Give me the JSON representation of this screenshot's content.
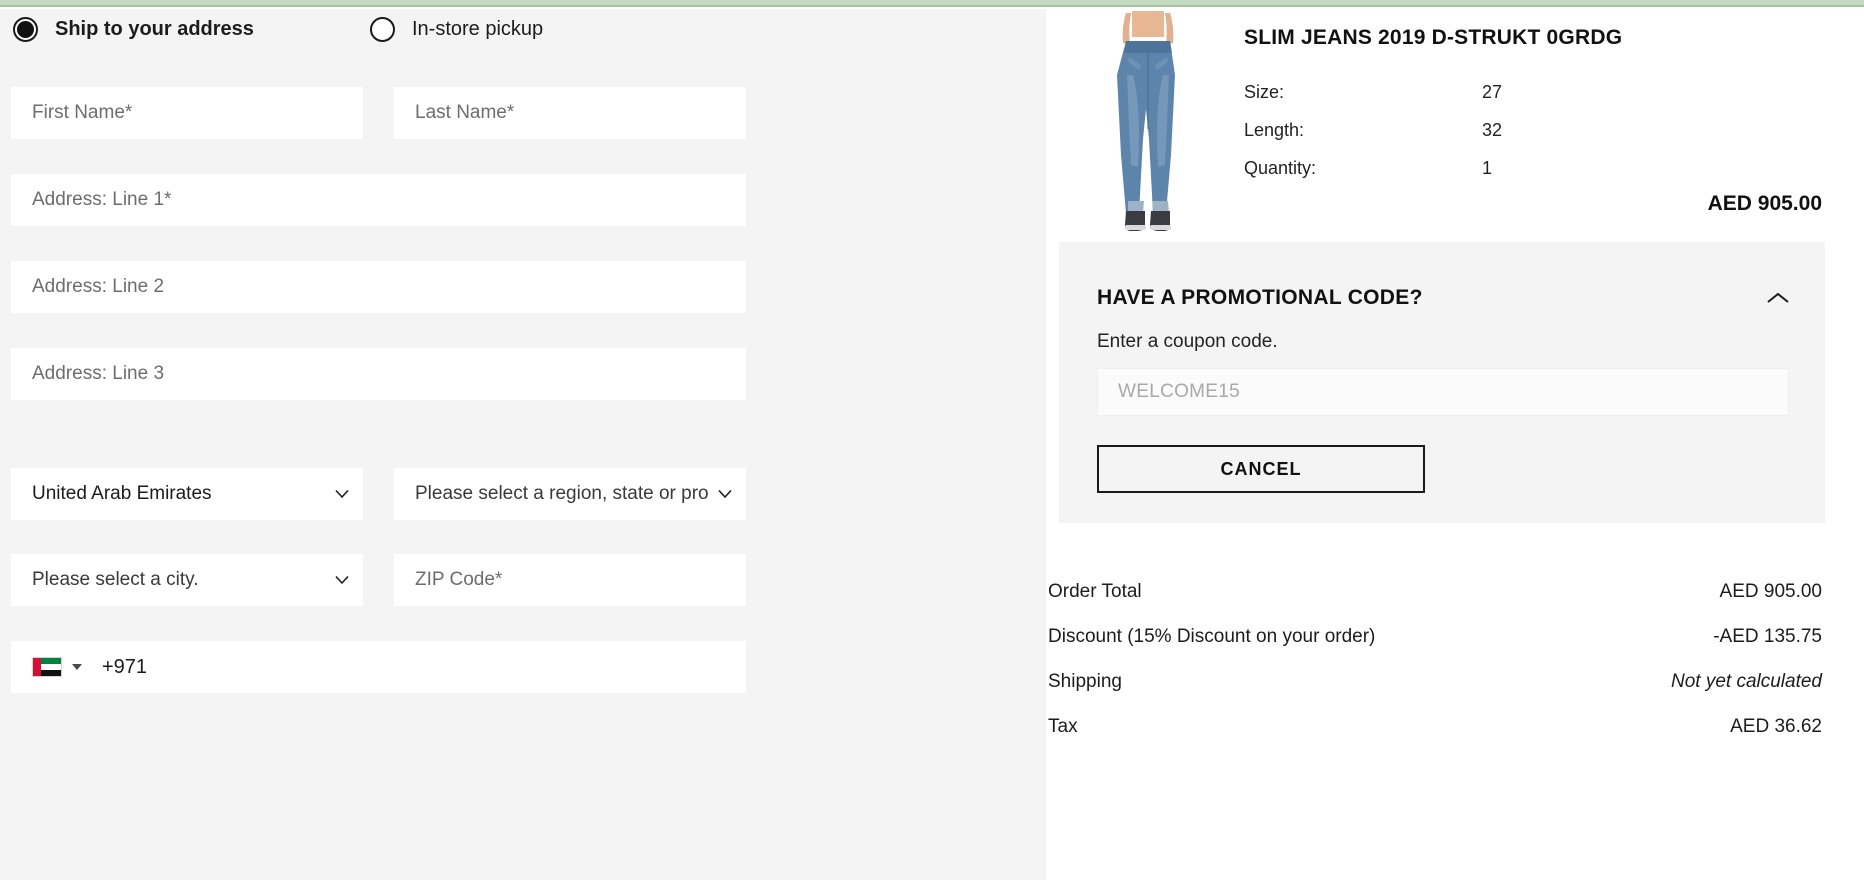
{
  "theme": {
    "page_bg": "#f4f4f4",
    "panel_bg": "#ffffff",
    "accent_green": "#c3dcc0",
    "field_bg": "#ffffff"
  },
  "delivery": {
    "options": [
      {
        "label": "Ship to your address",
        "selected": true
      },
      {
        "label": "In-store pickup",
        "selected": false
      }
    ]
  },
  "form": {
    "first_name": {
      "placeholder": "First Name*",
      "value": ""
    },
    "last_name": {
      "placeholder": "Last Name*",
      "value": ""
    },
    "address_line_1": {
      "placeholder": "Address: Line 1*",
      "value": ""
    },
    "address_line_2": {
      "placeholder": "Address: Line 2",
      "value": ""
    },
    "address_line_3": {
      "placeholder": "Address: Line 3",
      "value": ""
    },
    "country": {
      "selected": "United Arab Emirates"
    },
    "region": {
      "selected": "Please select a region, state or pro"
    },
    "city": {
      "selected": "Please select a city."
    },
    "zip": {
      "placeholder": "ZIP Code*",
      "value": ""
    },
    "phone": {
      "flag": "uae-flag-icon",
      "dial_code": "+971",
      "value": ""
    }
  },
  "product": {
    "image_alt": "slim-jeans-product-photo",
    "title": "SLIM JEANS 2019 D-STRUKT 0GRDG",
    "specs": [
      {
        "label": "Size:",
        "value": "27"
      },
      {
        "label": "Length:",
        "value": "32"
      },
      {
        "label": "Quantity:",
        "value": "1"
      }
    ],
    "price": "AED 905.00"
  },
  "promo": {
    "heading": "HAVE A PROMOTIONAL CODE?",
    "toggle_icon": "chevron-up-icon",
    "subtitle": "Enter a coupon code.",
    "input": {
      "placeholder": "WELCOME15",
      "value": ""
    },
    "cancel_label": "CANCEL"
  },
  "summary": {
    "rows": [
      {
        "label": "Order Total",
        "amount": "AED 905.00",
        "italic": false
      },
      {
        "label": "Discount (15% Discount on your order)",
        "amount": "-AED 135.75",
        "italic": false
      },
      {
        "label": "Shipping",
        "amount": "Not yet calculated",
        "italic": true
      },
      {
        "label": "Tax",
        "amount": "AED 36.62",
        "italic": false
      }
    ]
  }
}
